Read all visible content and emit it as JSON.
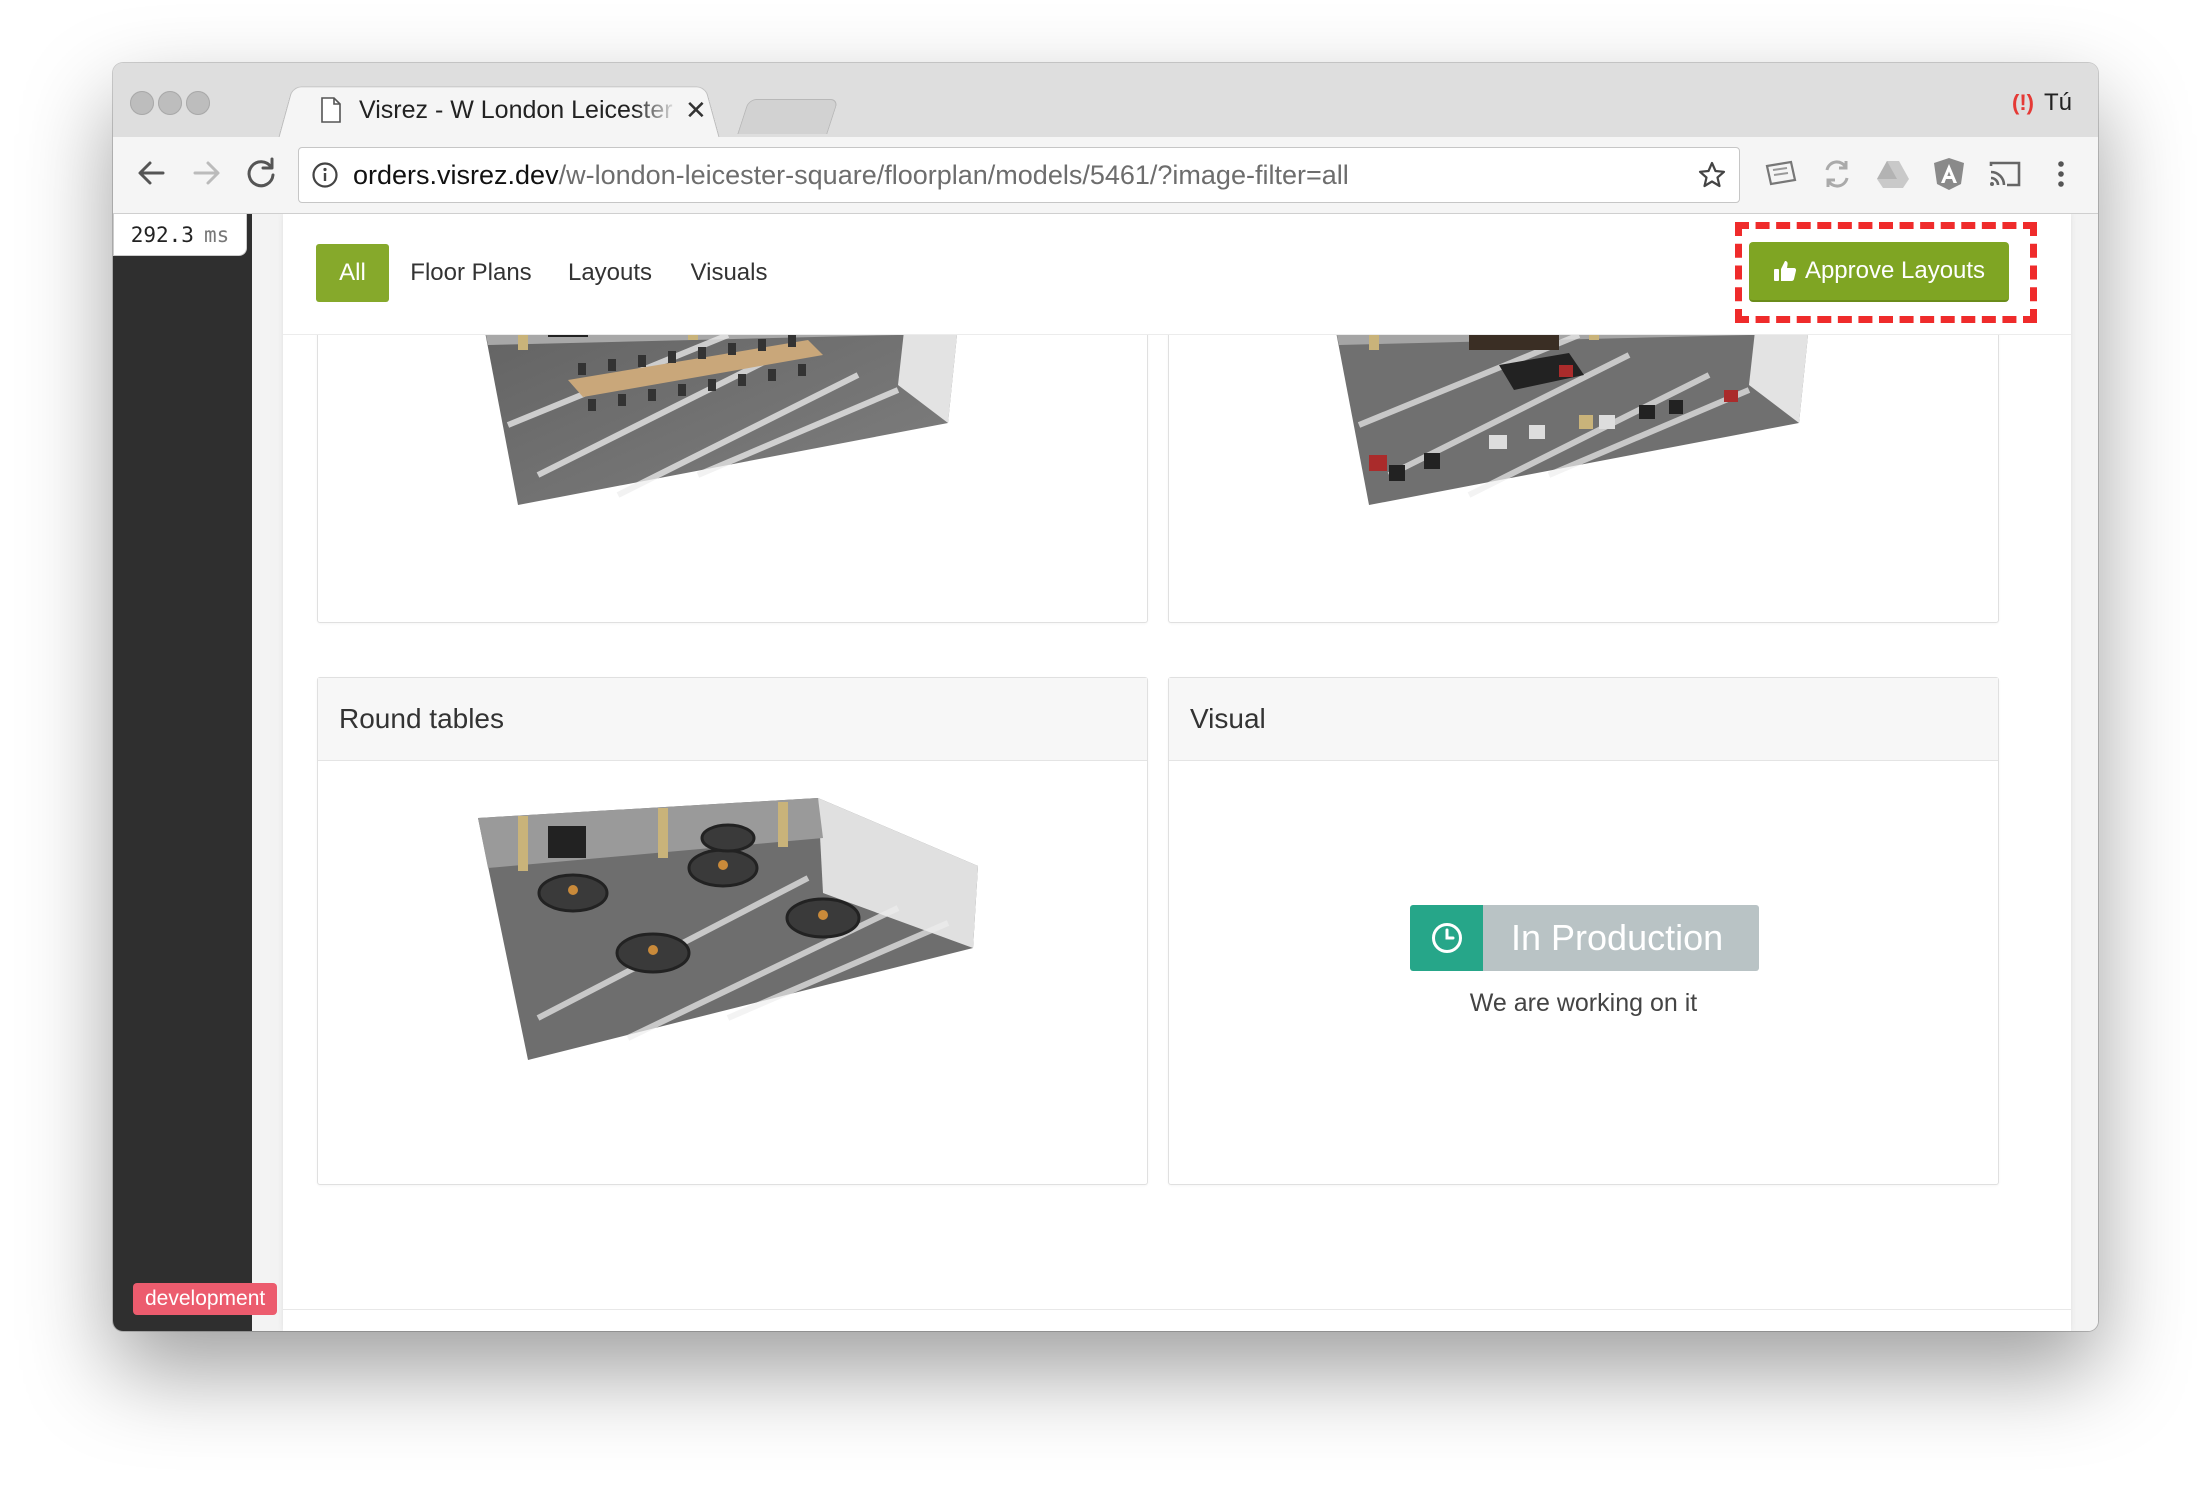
{
  "browser": {
    "tab_title": "Visrez - W London Leicester Square",
    "profile_name": "Tú",
    "url_host": "orders.visrez.dev",
    "url_path": "/w-london-leicester-square/floorplan/models/5461/?image-filter=all"
  },
  "debug": {
    "timing_value": "292.3",
    "timing_unit": "ms",
    "env_badge": "development"
  },
  "filters": {
    "all": "All",
    "floor_plans": "Floor Plans",
    "layouts": "Layouts",
    "visuals": "Visuals",
    "active": "All"
  },
  "actions": {
    "approve_label": "Approve Layouts"
  },
  "cards": {
    "round_tables": {
      "title": "Round tables"
    },
    "visual": {
      "title": "Visual",
      "status_label": "In Production",
      "status_sub": "We are working on it"
    }
  },
  "colors": {
    "accent_green": "#86a92b",
    "status_teal": "#26a689",
    "status_grey": "#b9c3c5",
    "highlight_red": "#ef2b2b",
    "dev_badge": "#ec5c6e"
  }
}
